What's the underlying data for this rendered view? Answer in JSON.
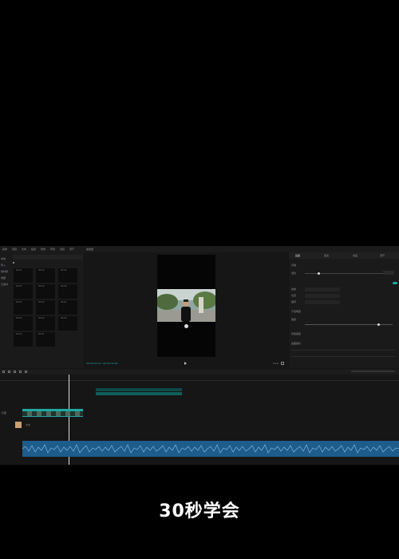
{
  "caption": "30秒学会",
  "topbar": {
    "menu": [
      "媒体",
      "音频",
      "文本",
      "贴纸",
      "特效",
      "转场",
      "滤镜",
      "调节"
    ],
    "player_title": "播放器"
  },
  "media": {
    "nav": [
      "本地",
      "导入",
      "素材库",
      "收藏",
      "云素材"
    ],
    "thumbnails": [
      "00:01",
      "00:03",
      "00:02",
      "00:05",
      "00:04",
      "00:06",
      "00:02",
      "00:03",
      "00:01",
      "00:04",
      "00:02",
      "00:05",
      "00:03",
      "00:01"
    ]
  },
  "preview": {
    "timecode": "00:00:03:12 / 00:00:30:00",
    "ratio": "9:16"
  },
  "props": {
    "tabs": [
      "画面",
      "变速",
      "动画",
      "调节"
    ],
    "labels": [
      "基础",
      "混合",
      "缩放",
      "位置",
      "旋转",
      "不透明度",
      "美颜",
      "智能美颜",
      "画面美化"
    ]
  },
  "timeline": {
    "clip_label": "文本",
    "cover_label": "封面"
  },
  "colors": {
    "accent": "#1fa9a1",
    "audio": "#1e5c8c",
    "text_clip": "#0d4a48"
  }
}
